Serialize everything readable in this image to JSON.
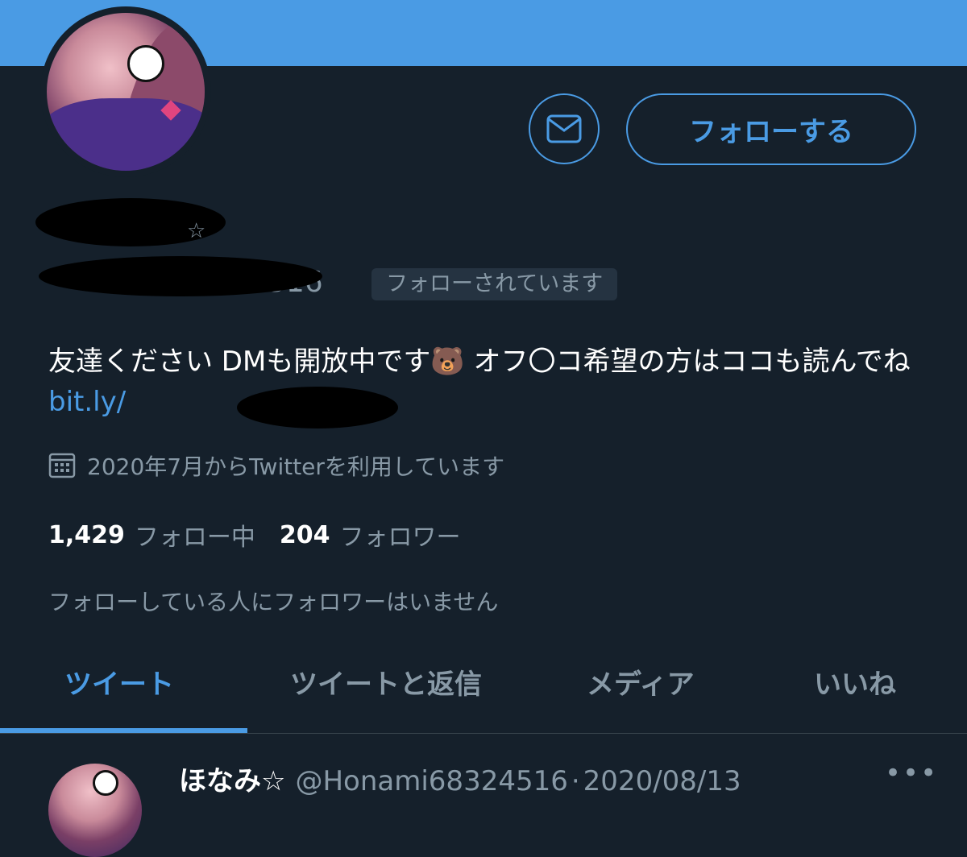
{
  "colors": {
    "banner": "#4a9be4",
    "background": "#15202b",
    "accent": "#4a9be4",
    "muted": "#8899a6",
    "badge_bg": "#253341"
  },
  "header": {
    "message_icon": "envelope-icon",
    "follow_label": "フォローする"
  },
  "profile": {
    "name_visible": "☆",
    "handle_visible": "516",
    "follows_you_badge": "フォローされています",
    "bio_text": "友達ください DMも開放中です🐻 オフ〇コ希望の方はココも読んでね",
    "bio_link": "bit.ly/",
    "joined_icon": "calendar-icon",
    "joined": "2020年7月からTwitterを利用しています",
    "following_count": "1,429",
    "following_label": "フォロー中",
    "followers_count": "204",
    "followers_label": "フォロワー",
    "mutuals_note": "フォローしている人にフォロワーはいません"
  },
  "tabs": [
    {
      "label": "ツイート"
    },
    {
      "label": "ツイートと返信"
    },
    {
      "label": "メディア"
    },
    {
      "label": "いいね"
    }
  ],
  "tweet": {
    "name": "ほなみ☆",
    "handle": "@Honami68324516",
    "separator": "·",
    "date": "2020/08/13",
    "more": "•••"
  }
}
